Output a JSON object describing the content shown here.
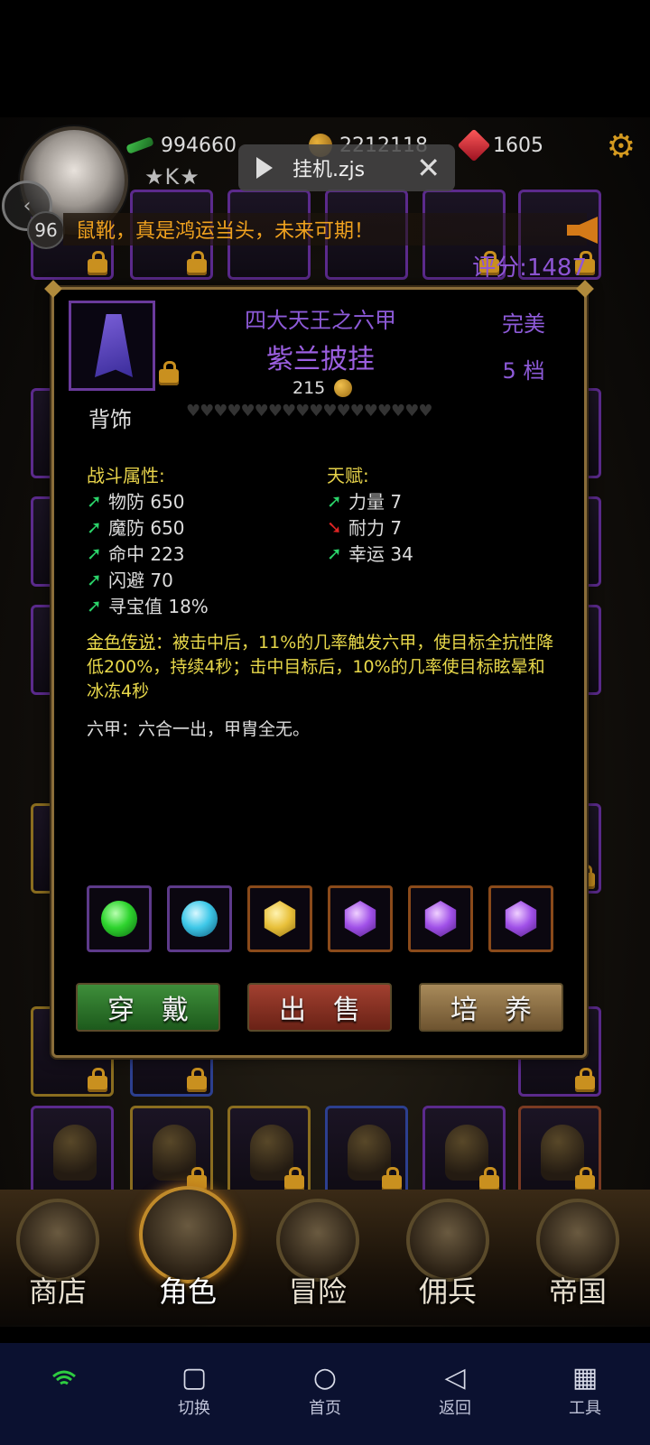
{
  "hud": {
    "level": "96",
    "stars": "★K★",
    "resources": [
      {
        "icon": "green-arrow-icon",
        "value": "994660",
        "color": "#3fbf4a"
      },
      {
        "icon": "gold-coin-icon",
        "value": "2212118",
        "color": "#c8922a"
      },
      {
        "icon": "red-gem-icon",
        "value": "1605",
        "color": "#d8283a"
      }
    ],
    "overlay_label": "挂机.zjs",
    "marquee_text": "鼠靴，真是鸿运当头，未来可期！",
    "score": "评分:1487"
  },
  "item": {
    "set_name": "四大天王之六甲",
    "name": "紫兰披挂",
    "quality": "完美",
    "tier": "5 档",
    "price": "215",
    "slot_type": "背饰",
    "hearts": "♥♥♥♥♥♥♥♥♥♥♥♥♥♥♥♥♥♥",
    "combat_title": "战斗属性:",
    "combat_stats": [
      {
        "dir": "up",
        "text": "物防 650"
      },
      {
        "dir": "up",
        "text": "魔防 650"
      },
      {
        "dir": "up",
        "text": "命中 223"
      },
      {
        "dir": "up",
        "text": "闪避 70"
      },
      {
        "dir": "up",
        "text": "寻宝值 18%"
      }
    ],
    "talent_title": "天赋:",
    "talent_stats": [
      {
        "dir": "up",
        "text": "力量 7"
      },
      {
        "dir": "down",
        "text": "耐力 7"
      },
      {
        "dir": "up",
        "text": "幸运 34"
      }
    ],
    "legend_name": "金色传说",
    "legend_text": "：被击中后，11%的几率触发六甲，使目标全抗性降低200%，持续4秒；击中目标后，10%的几率使目标眩晕和冰冻4秒",
    "flavor": "六甲：六合一出，甲胄全无。",
    "gems": [
      {
        "icon": "green-gem-icon",
        "color": "#2ed42e",
        "border": "purple"
      },
      {
        "icon": "cyan-gem-icon",
        "color": "#3ec8e8",
        "border": "purple"
      },
      {
        "icon": "yellow-gem-icon",
        "color": "#e8c03a",
        "border": "orange"
      },
      {
        "icon": "purple-gem-icon",
        "color": "#a050e8",
        "border": "orange"
      },
      {
        "icon": "purple-gem-icon",
        "color": "#a050e8",
        "border": "orange"
      },
      {
        "icon": "purple-gem-icon",
        "color": "#a050e8",
        "border": "orange"
      }
    ],
    "buttons": {
      "equip": "穿戴",
      "sell": "出售",
      "cultivate": "培养"
    }
  },
  "nav": {
    "items": [
      {
        "label": "商店",
        "icon": "shop-icon"
      },
      {
        "label": "角色",
        "icon": "hooded-character-icon",
        "active": true
      },
      {
        "label": "冒险",
        "icon": "crossed-swords-icon"
      },
      {
        "label": "佣兵",
        "icon": "mercenary-card-icon"
      },
      {
        "label": "帝国",
        "icon": "crown-icon"
      }
    ]
  },
  "system_bar": {
    "items": [
      {
        "label": "切换",
        "icon": "square-icon"
      },
      {
        "label": "首页",
        "icon": "circle-icon"
      },
      {
        "label": "返回",
        "icon": "back-triangle-icon"
      },
      {
        "label": "工具",
        "icon": "grid-icon"
      }
    ]
  },
  "colors": {
    "accent_purple": "#9b5fe0",
    "legend_yellow": "#e8d84a",
    "frame_gold": "#8a6d3a"
  }
}
